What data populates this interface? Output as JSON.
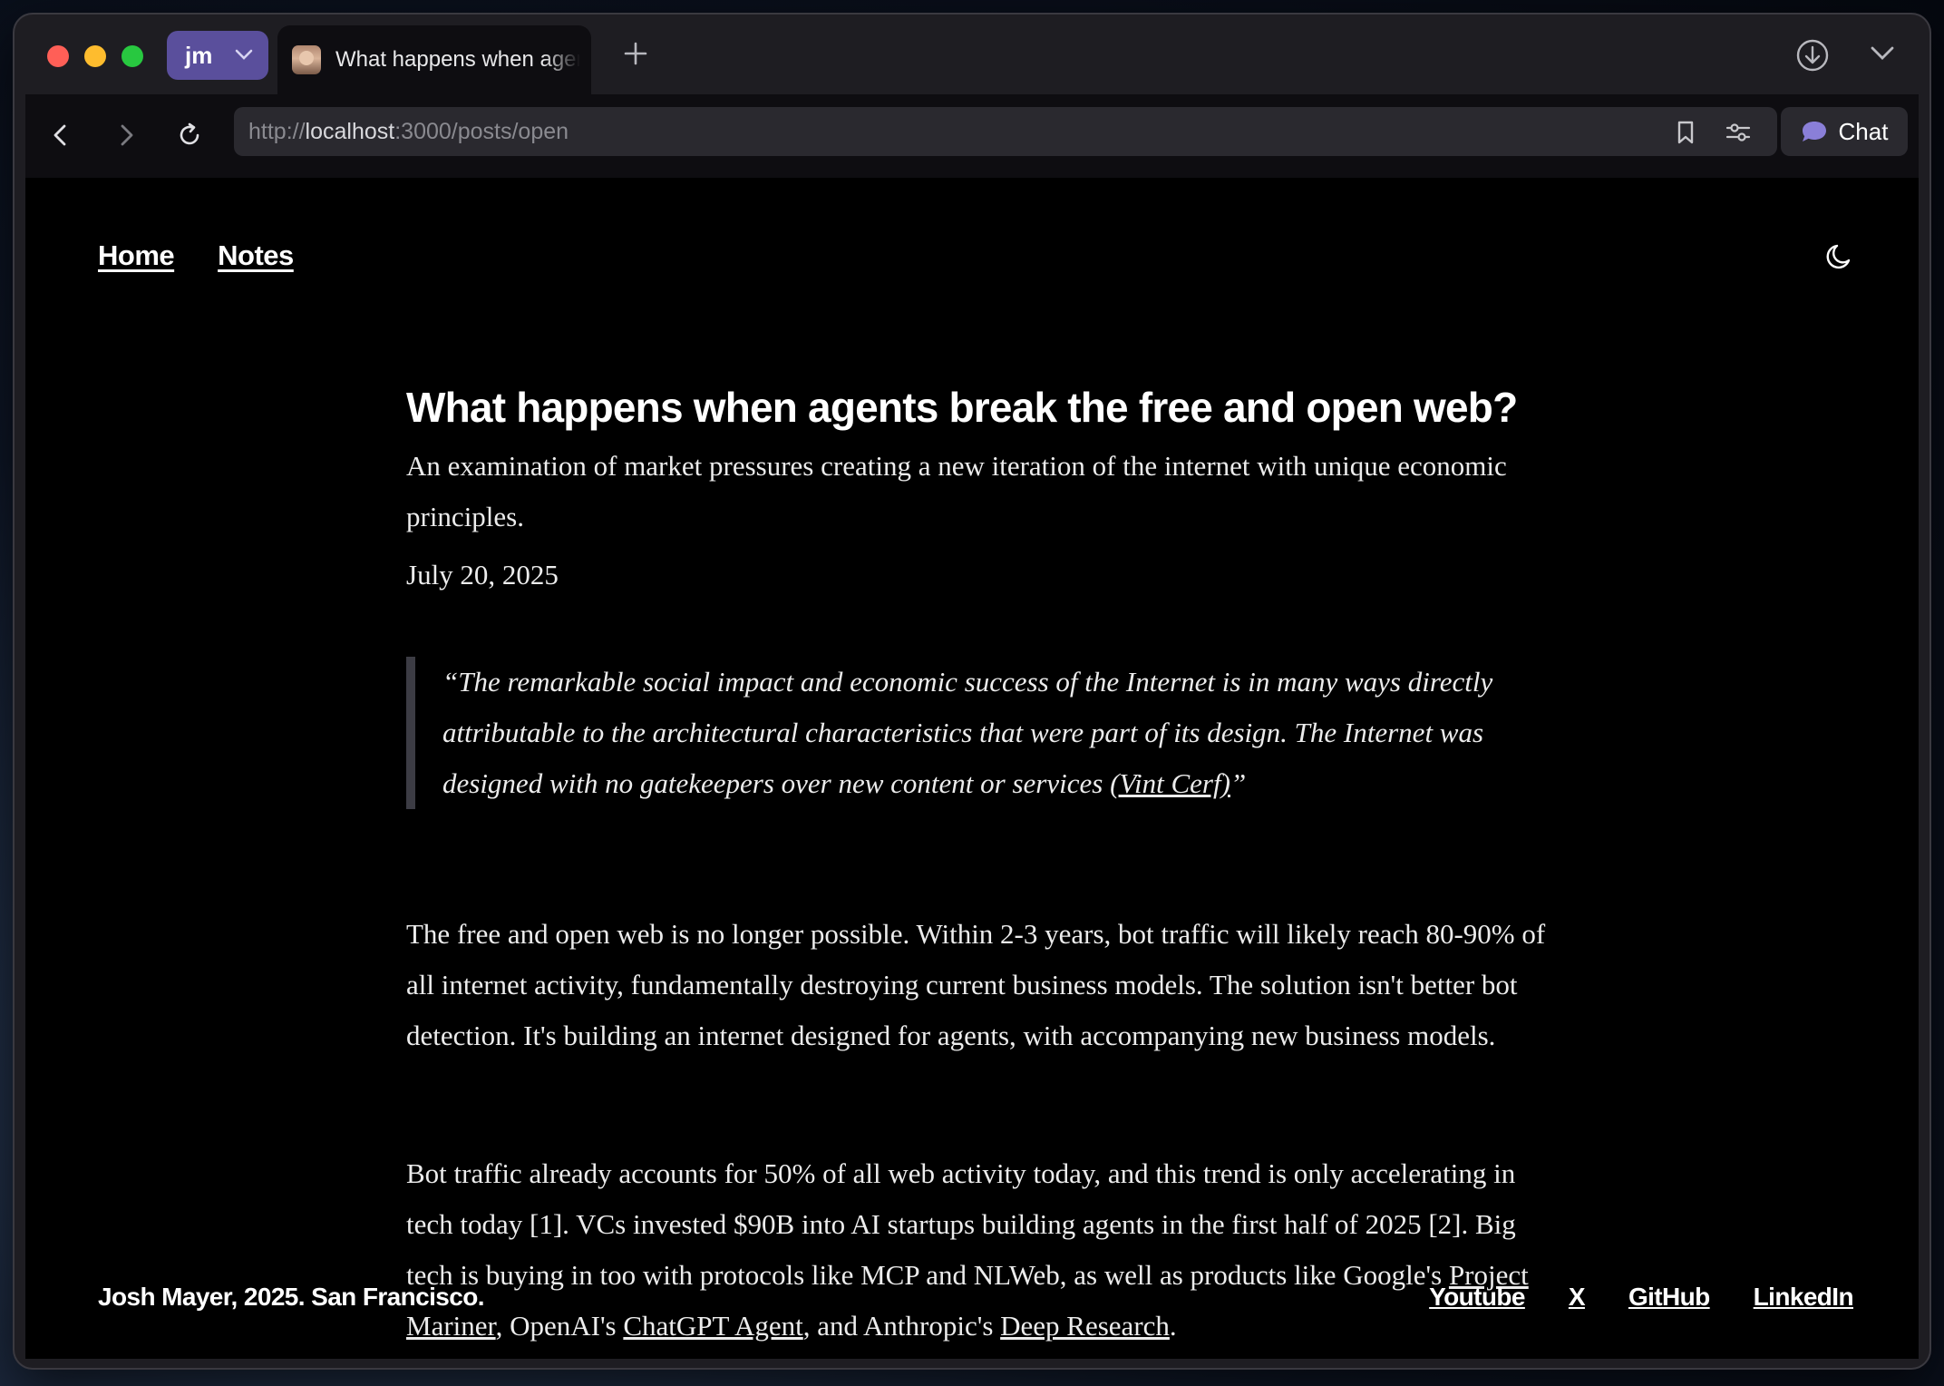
{
  "browser": {
    "profile_label": "jm",
    "tab_title": "What happens when agents break the free and open web?",
    "url_scheme": "http://",
    "url_host": "localhost",
    "url_path": ":3000/posts/open",
    "chat_label": "Chat",
    "icons": [
      "chevron-down-icon",
      "plus-icon",
      "download-icon",
      "back-icon",
      "forward-icon",
      "reload-icon",
      "bookmark-icon",
      "sliders-icon",
      "chat-bubble-icon"
    ]
  },
  "site": {
    "nav": {
      "home": "Home",
      "notes": "Notes"
    },
    "theme_icon": "moon-icon"
  },
  "post": {
    "title": "What happens when agents break the free and open web?",
    "subtitle": "An examination of market pressures creating a new iteration of the internet with unique economic principles.",
    "date": "July 20, 2025",
    "quote_text": "“The remarkable social impact and economic success of the Internet is in many ways directly attributable to the architectural characteristics that were part of its design. The Internet was designed with no gatekeepers over new content or services ",
    "quote_link": "(Vint Cerf)",
    "quote_close": "”",
    "p1": "The free and open web is no longer possible. Within 2-3 years, bot traffic will likely reach 80-90% of all internet activity, fundamentally destroying current business models. The solution isn't better bot detection. It's building an internet designed for agents, with accompanying new business models.",
    "p2_a": "Bot traffic already accounts for 50% of all web activity today, and this trend is only accelerating in tech today [1]. VCs invested $90B into AI startups building agents in the first half of 2025 [2]. Big tech is buying in too with protocols like MCP and NLWeb, as well as products like Google's ",
    "p2_link1": "Project Mariner",
    "p2_b": ", OpenAI's ",
    "p2_link2": "ChatGPT Agent",
    "p2_c": ", and Anthropic's ",
    "p2_link3": "Deep Research",
    "p2_d": "."
  },
  "footer": {
    "credit": "Josh Mayer, 2025. San Francisco.",
    "links": {
      "youtube": "Youtube",
      "x": "X",
      "github": "GitHub",
      "linkedin": "LinkedIn"
    }
  },
  "colors": {
    "profile": "#5a4f9c",
    "chat_bubble": "#8a7fd8",
    "page_bg": "#000000"
  }
}
